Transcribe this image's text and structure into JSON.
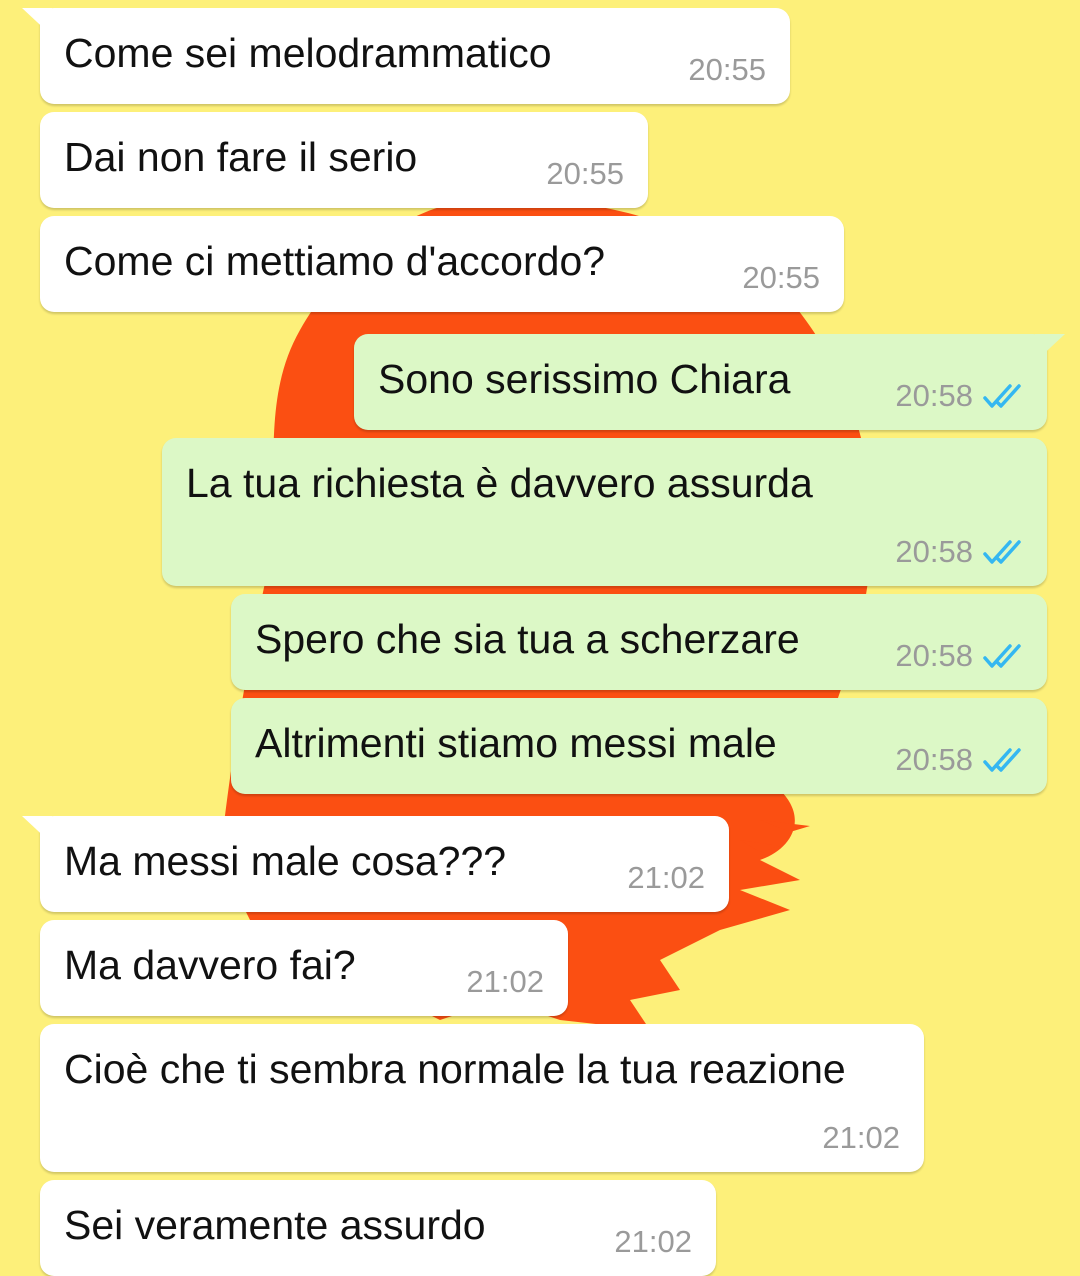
{
  "colors": {
    "background": "#fdf07a",
    "incoming_bubble": "#ffffff",
    "outgoing_bubble": "#dcf8c6",
    "timestamp": "#9a9a9a",
    "read_ticks": "#34b7f1",
    "wallpaper_splash": "#fb4f12"
  },
  "messages": [
    {
      "text": "Come sei melodrammatico",
      "time": "20:55",
      "direction": "incoming"
    },
    {
      "text": "Dai non fare il serio",
      "time": "20:55",
      "direction": "incoming"
    },
    {
      "text": "Come ci mettiamo d'accordo?",
      "time": "20:55",
      "direction": "incoming"
    },
    {
      "text": "Sono serissimo Chiara",
      "time": "20:58",
      "direction": "outgoing",
      "status": "read-ticks-icon"
    },
    {
      "text": "La tua richiesta è davvero assurda",
      "time": "20:58",
      "direction": "outgoing",
      "status": "read-ticks-icon"
    },
    {
      "text": "Spero che sia tua a scherzare",
      "time": "20:58",
      "direction": "outgoing",
      "status": "read-ticks-icon"
    },
    {
      "text": "Altrimenti stiamo messi male",
      "time": "20:58",
      "direction": "outgoing",
      "status": "read-ticks-icon"
    },
    {
      "text": "Ma messi male cosa???",
      "time": "21:02",
      "direction": "incoming"
    },
    {
      "text": "Ma davvero fai?",
      "time": "21:02",
      "direction": "incoming"
    },
    {
      "text": "Cioè che ti sembra normale la tua reazione",
      "time": "21:02",
      "direction": "incoming"
    },
    {
      "text": "Sei veramente assurdo",
      "time": "21:02",
      "direction": "incoming"
    }
  ]
}
